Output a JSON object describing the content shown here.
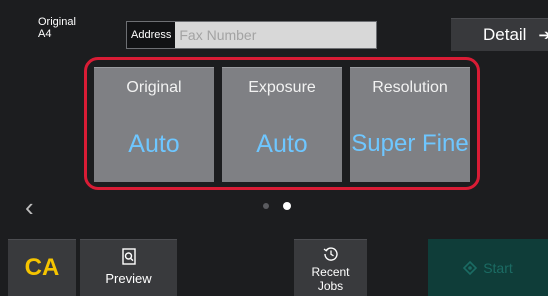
{
  "header": {
    "original_label": "Original",
    "original_size": "A4",
    "address_label": "Address",
    "address_placeholder": "Fax Number",
    "detail_label": "Detail",
    "detail_arrow": "➔"
  },
  "settings": {
    "tiles": [
      {
        "title": "Original",
        "value": "Auto",
        "icon": "none"
      },
      {
        "title": "Exposure",
        "value": "Auto",
        "icon": "none"
      },
      {
        "title": "Resolution",
        "value": "Super Fine",
        "icon": "none"
      }
    ],
    "highlight_color": "#d91c35",
    "value_color": "#6ec6ff"
  },
  "pager": {
    "prev_glyph": "‹",
    "page_count": 2,
    "current_page": 2
  },
  "bottom_bar": {
    "ca_label": "CA",
    "preview_label": "Preview",
    "recent_label_line1": "Recent",
    "recent_label_line2": "Jobs",
    "start_label": "Start",
    "start_enabled": false
  },
  "icons": {
    "preview": "preview-icon",
    "recent": "history-icon",
    "start": "diamond-icon",
    "prev": "chevron-left-icon"
  }
}
